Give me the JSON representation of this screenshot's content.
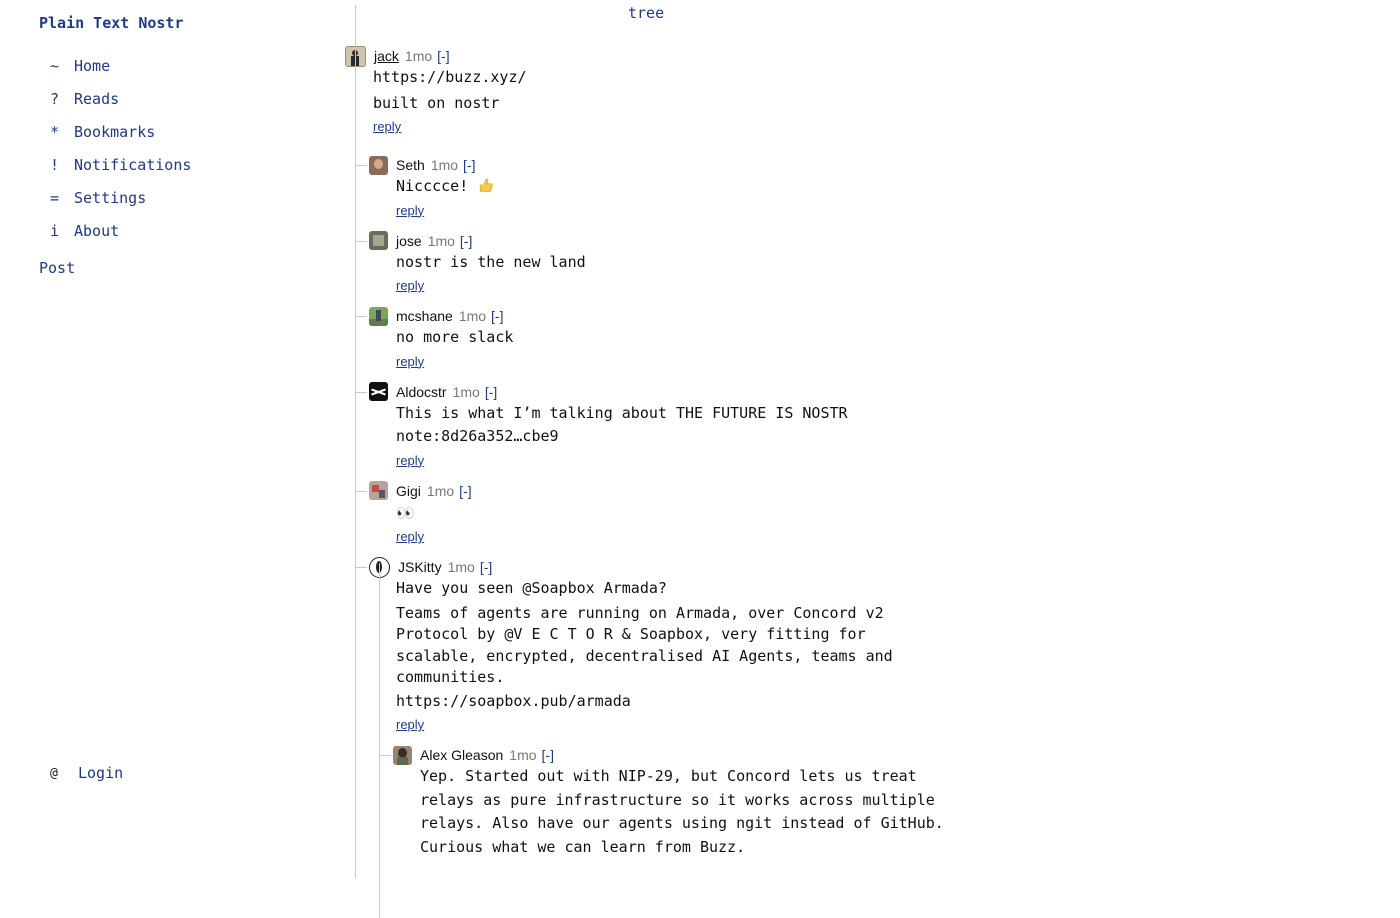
{
  "brand": "Plain Text Nostr",
  "view_title": "tree",
  "nav": [
    {
      "symbol": "~",
      "label": "Home"
    },
    {
      "symbol": "?",
      "label": "Reads"
    },
    {
      "symbol": "*",
      "label": "Bookmarks"
    },
    {
      "symbol": "!",
      "label": "Notifications"
    },
    {
      "symbol": "=",
      "label": "Settings"
    },
    {
      "symbol": "i",
      "label": "About"
    }
  ],
  "post_link": "Post",
  "login": {
    "symbol": "@",
    "label": "Login"
  },
  "thread": {
    "root": {
      "author": "jack",
      "time": "1mo",
      "collapse": "[-]",
      "lines": [
        "https://buzz.xyz/",
        "built on nostr"
      ],
      "reply": "reply"
    },
    "replies": [
      {
        "author": "Seth",
        "time": "1mo",
        "collapse": "[-]",
        "lines": [
          "Nicccce!"
        ],
        "reply": "reply"
      },
      {
        "author": "jose",
        "time": "1mo",
        "collapse": "[-]",
        "lines": [
          "nostr is the new land"
        ],
        "reply": "reply"
      },
      {
        "author": "mcshane",
        "time": "1mo",
        "collapse": "[-]",
        "lines": [
          "no more slack"
        ],
        "reply": "reply"
      },
      {
        "author": "Aldocstr",
        "time": "1mo",
        "collapse": "[-]",
        "lines": [
          "This is what I’m talking about THE FUTURE IS NOSTR",
          "note:8d26a352…cbe9"
        ],
        "reply": "reply"
      },
      {
        "author": "Gigi",
        "time": "1mo",
        "collapse": "[-]",
        "lines": [
          "👀"
        ],
        "reply": "reply"
      },
      {
        "author": "JSKitty",
        "time": "1mo",
        "collapse": "[-]",
        "lines": [
          "Have you seen @Soapbox Armada?",
          "Teams of agents are running on Armada, over Concord v2",
          "Protocol by @V E C T O R & Soapbox, very fitting for",
          "scalable, encrypted, decentralised AI Agents, teams and",
          "communities.",
          "https://soapbox.pub/armada"
        ],
        "reply": "reply"
      }
    ],
    "nested": {
      "author": "Alex Gleason",
      "time": "1mo",
      "collapse": "[-]",
      "lines": [
        "Yep. Started out with NIP-29, but Concord lets us treat",
        "relays as pure infrastructure so it works across multiple",
        "relays. Also have our agents using ngit instead of GitHub.",
        "Curious what we can learn from Buzz."
      ]
    }
  }
}
